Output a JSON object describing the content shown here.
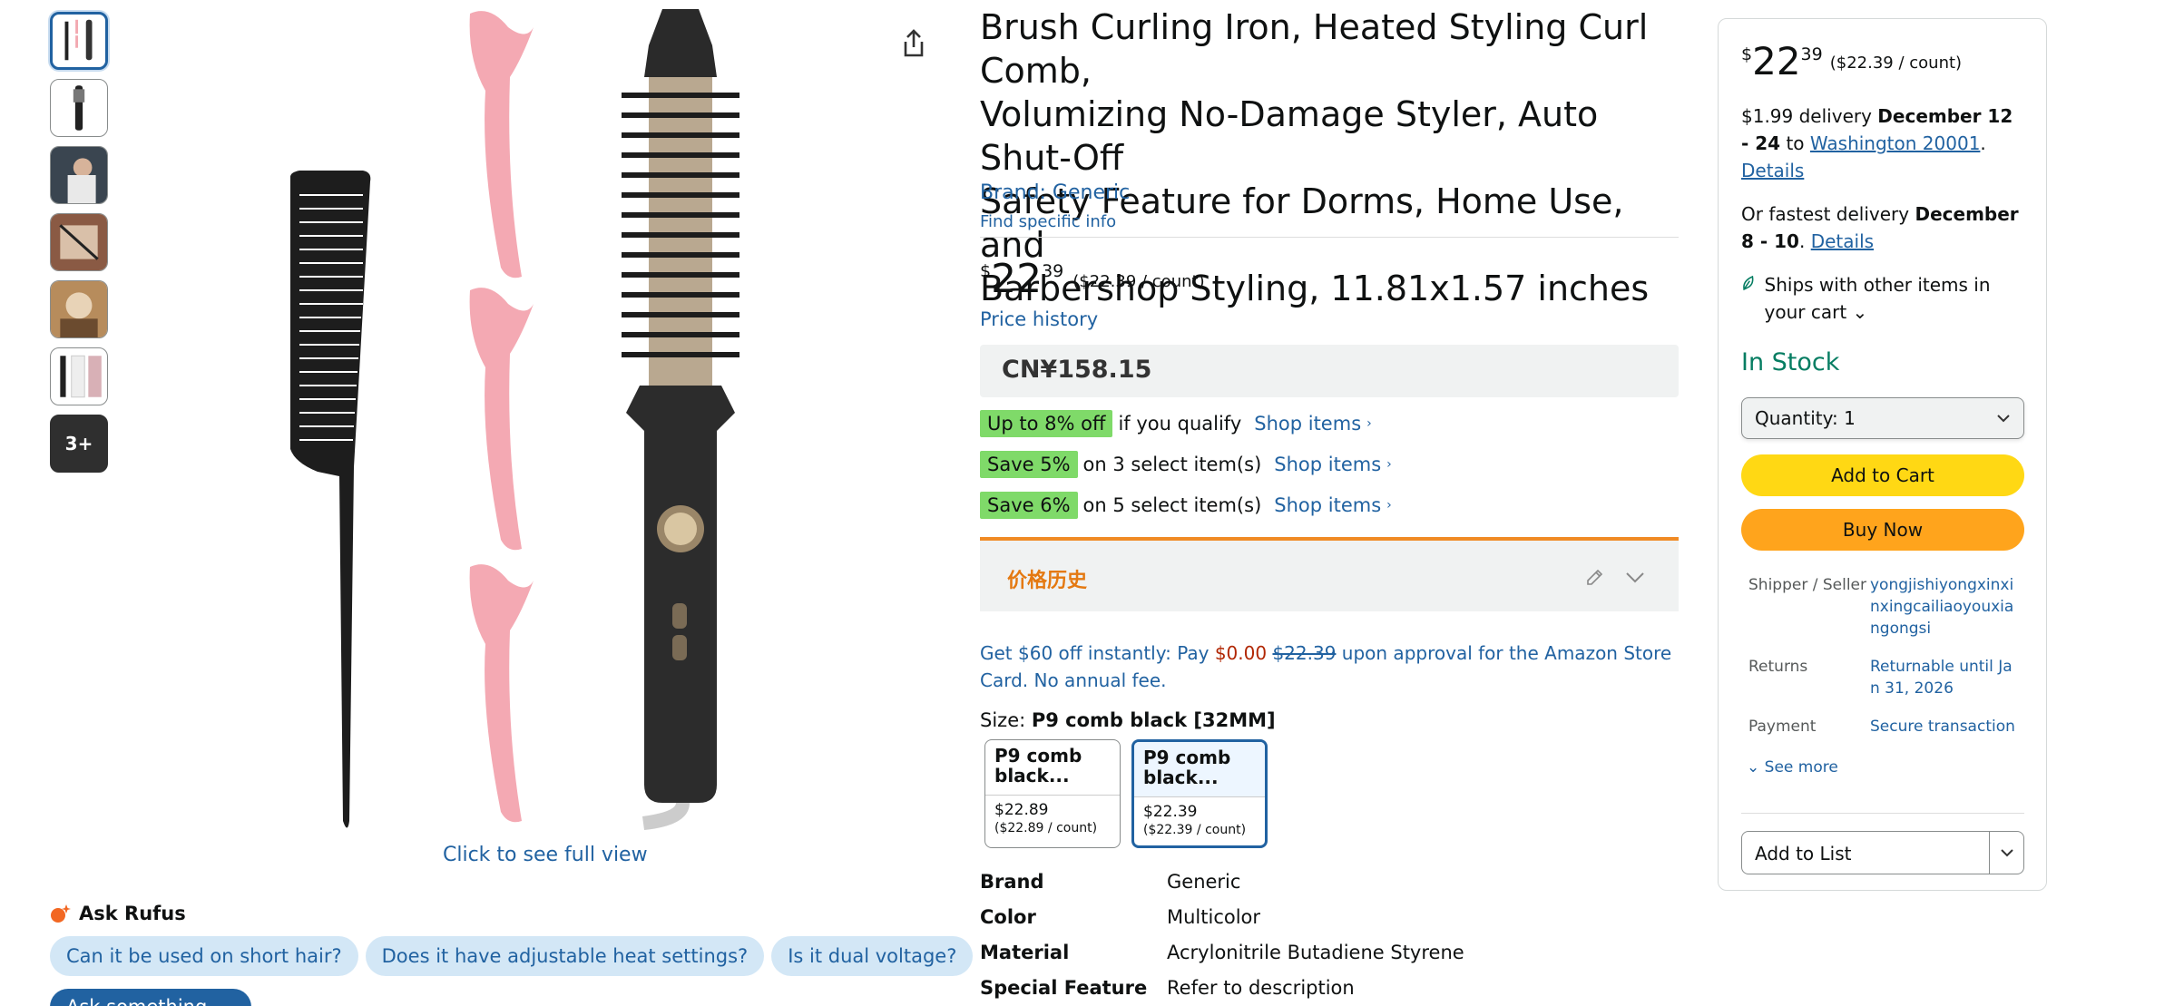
{
  "gallery": {
    "thumbnails": [
      "thumb-1",
      "thumb-2",
      "thumb-3",
      "thumb-4",
      "thumb-5",
      "thumb-6"
    ],
    "more_label": "3+",
    "full_view_label": "Click to see full view"
  },
  "rufus": {
    "title": "Ask Rufus",
    "questions": [
      "Can it be used on short hair?",
      "Does it have adjustable heat settings?",
      "Is it dual voltage?"
    ],
    "ask_label": "Ask something else"
  },
  "product": {
    "title_lines": [
      "Brush Curling Iron, Heated Styling Curl Comb,",
      "Volumizing No-Damage Styler, Auto Shut-Off",
      "Safety Feature for Dorms, Home Use, and",
      "Barbershop Styling, 11.81x1.57 inches"
    ],
    "brand_link": "Brand: Generic",
    "specific_info": "Find specific info",
    "price_symbol": "$",
    "price_whole": "22",
    "price_fraction": "39",
    "price_unit": "($22.39 / count)",
    "price_history": "Price history",
    "cny_price": "CN¥158.15",
    "promos": [
      {
        "badge": "Up to 8% off",
        "text": "if you qualify",
        "link": "Shop items"
      },
      {
        "badge": "Save 5%",
        "text": "on 3 select item(s)",
        "link": "Shop items"
      },
      {
        "badge": "Save 6%",
        "text": "on 5 select item(s)",
        "link": "Shop items"
      }
    ],
    "price_history_cn": "价格历史",
    "card_offer": {
      "pre": "Get $60 off instantly: Pay ",
      "pay": "$0.00",
      "was": "$22.39",
      "post": " upon approval for the Amazon Store Card. No annual fee."
    },
    "size_label": "Size: ",
    "size_selected": "P9 comb black [32MM]",
    "sizes": [
      {
        "name": "P9 comb black...",
        "price": "$22.89",
        "unit": "($22.89 / count)"
      },
      {
        "name": "P9 comb black...",
        "price": "$22.39",
        "unit": "($22.39 / count)"
      }
    ],
    "attributes": [
      {
        "k": "Brand",
        "v": "Generic"
      },
      {
        "k": "Color",
        "v": "Multicolor"
      },
      {
        "k": "Material",
        "v": "Acrylonitrile Butadiene Styrene"
      },
      {
        "k": "Special Feature",
        "v": "Refer to description"
      }
    ]
  },
  "buybox": {
    "price_symbol": "$",
    "price_whole": "22",
    "price_fraction": "39",
    "price_unit": "($22.39 / count)",
    "delivery_fee": "$1.99 delivery ",
    "delivery_date": "December 12 - 24",
    "to": " to ",
    "location": "Washington 20001",
    "details": "Details",
    "fastest_pre": "Or fastest delivery ",
    "fastest_date": "December 8 - 10",
    "ships_with": "Ships with other items in your cart",
    "stock": "In Stock",
    "quantity_label": "Quantity:",
    "quantity_value": "1",
    "add_to_cart": "Add to Cart",
    "buy_now": "Buy Now",
    "shipper_k": "Shipper / Seller",
    "shipper_v": "yongjishiyongxinxinxingcailiaoyouxiangongsi",
    "returns_k": "Returns",
    "returns_v": "Returnable until Jan 31, 2026",
    "payment_k": "Payment",
    "payment_v": "Secure transaction",
    "see_more": "See more",
    "add_to_list": "Add to List"
  }
}
